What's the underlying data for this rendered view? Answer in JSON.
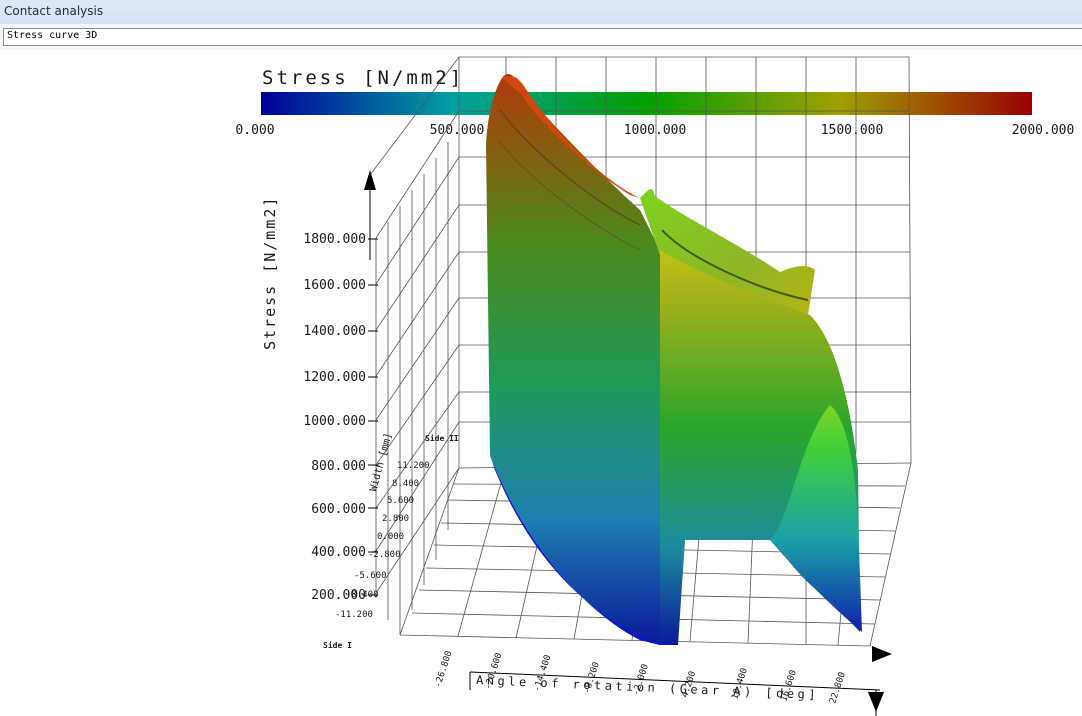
{
  "window": {
    "title": "Contact analysis"
  },
  "view_selector": {
    "value": "Stress curve 3D"
  },
  "colorbar": {
    "title": "Stress [N/mm2]",
    "ticks": [
      "0.000",
      "500.000",
      "1000.000",
      "1500.000",
      "2000.000"
    ],
    "colors": [
      "#000099",
      "#00a0a0",
      "#00a000",
      "#a0a000",
      "#990000"
    ]
  },
  "chart_data": {
    "type": "surface",
    "z_axis": {
      "label": "Stress [N/mm2]",
      "ticks": [
        "200.000",
        "400.000",
        "600.000",
        "800.000",
        "1000.000",
        "1200.000",
        "1400.000",
        "1600.000",
        "1800.000"
      ]
    },
    "y_axis": {
      "label": "Width [mm]",
      "ticks": [
        "11.200",
        "8.400",
        "5.600",
        "2.800",
        "0.000",
        "-2.800",
        "-5.600",
        "-8.400",
        "-11.200"
      ],
      "side_labels": [
        "Side II",
        "Side I"
      ]
    },
    "x_axis": {
      "label": "Angle of rotation (Gear A) [deg]",
      "ticks": [
        "-26.800",
        "-20.600",
        "-14.400",
        "-8.200",
        "-2.000",
        "4.200",
        "10.400",
        "16.600",
        "22.800"
      ]
    },
    "color_range": [
      0,
      2000
    ]
  }
}
